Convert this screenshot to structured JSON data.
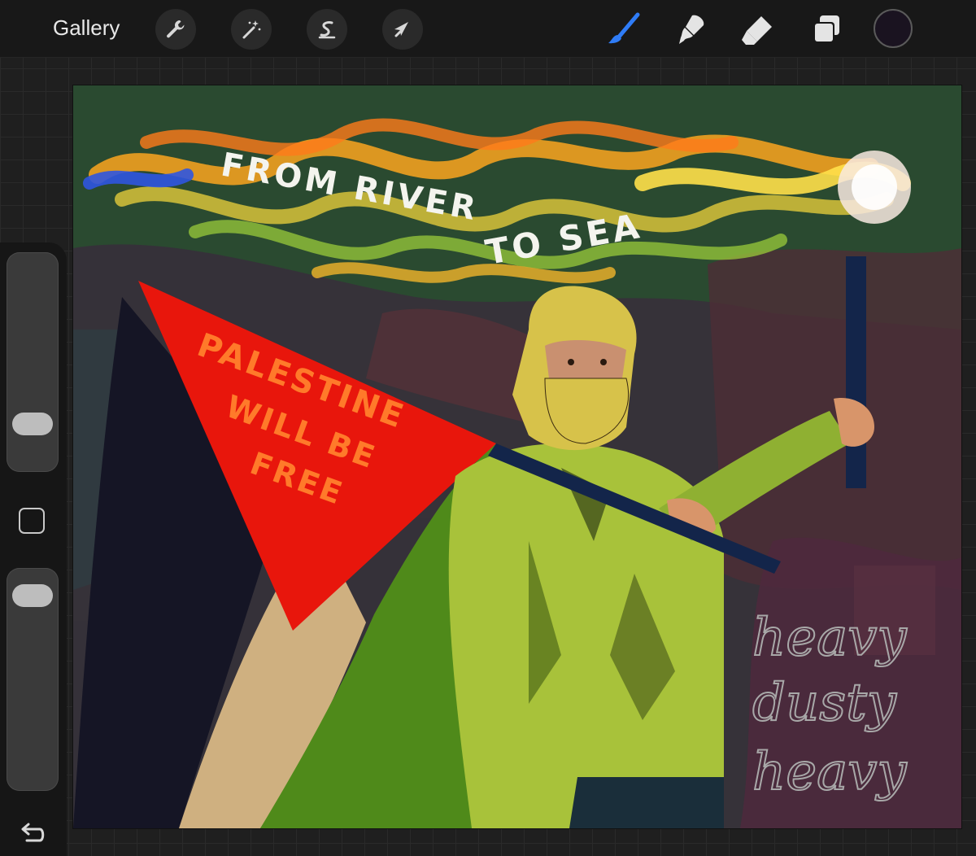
{
  "app": {
    "gallery_label": "Gallery",
    "actions": [
      {
        "name": "actions-icon",
        "label": "Actions"
      },
      {
        "name": "adjustments-icon",
        "label": "Adjustments"
      },
      {
        "name": "selection-icon",
        "label": "Selection"
      },
      {
        "name": "transform-icon",
        "label": "Transform"
      }
    ],
    "tools": [
      {
        "name": "brush-icon",
        "active": true
      },
      {
        "name": "smudge-icon",
        "active": false
      },
      {
        "name": "eraser-icon",
        "active": false
      },
      {
        "name": "layers-icon",
        "active": false
      }
    ],
    "active_color": "#1a1320",
    "accent_color": "#2f7cf6"
  },
  "sidebar": {
    "brush_size_level": 0.17,
    "opacity_level": 0.94
  },
  "artwork": {
    "banner_line1": "FROM RIVER",
    "banner_line2": "TO SEA",
    "flag_line1": "PALESTINE",
    "flag_line2": "WILL BE",
    "flag_line3": "FREE",
    "signature_line1": "heavy",
    "signature_line2": "dusty",
    "signature_line3": "heavy",
    "colors": {
      "background": "#2a4a30",
      "flag_red": "#e8160c",
      "flag_black": "#151525",
      "flag_beige": "#cfb080",
      "flag_green": "#4f8a1a",
      "shirt": "#a8c23a"
    }
  }
}
